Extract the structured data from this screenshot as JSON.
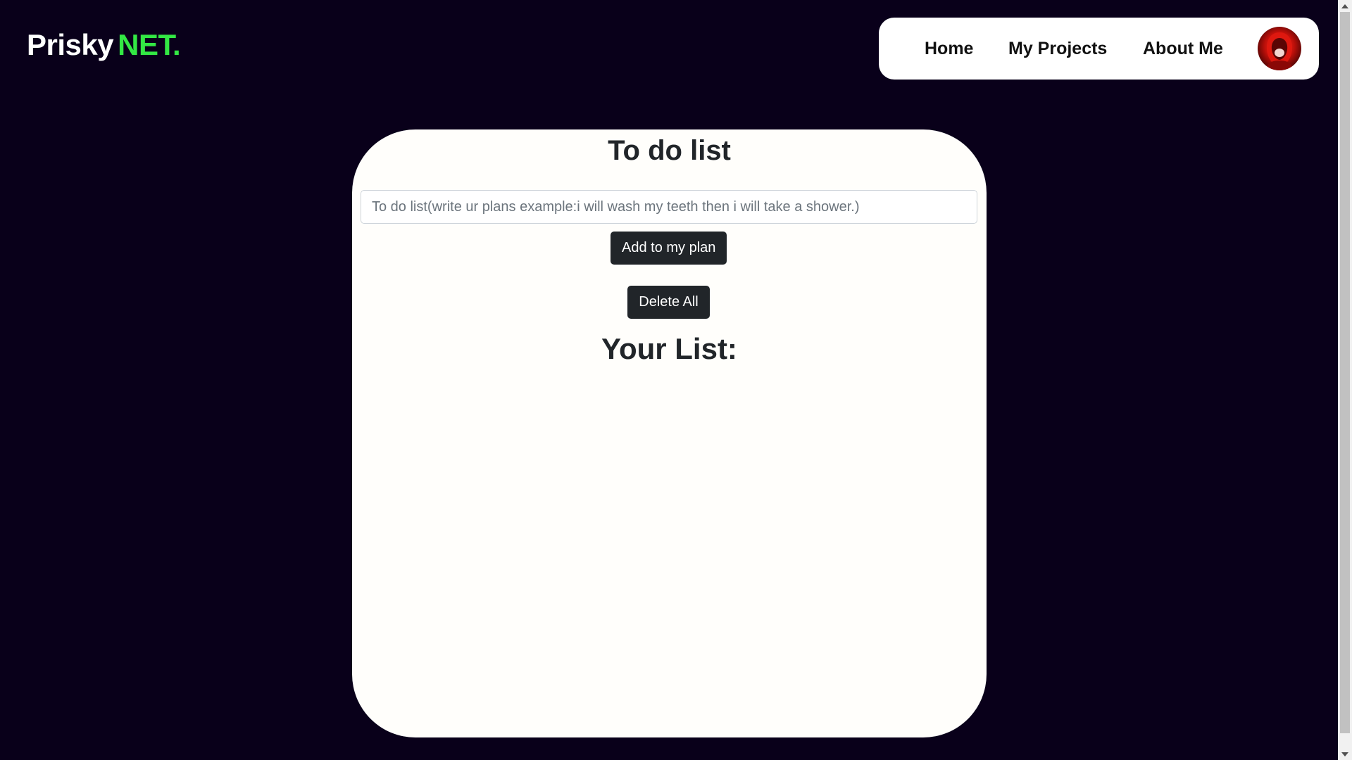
{
  "logo": {
    "text": "Prisky",
    "accent": "NET.",
    "accent_color": "#33e844"
  },
  "nav": {
    "items": [
      {
        "label": "Home"
      },
      {
        "label": "My Projects"
      },
      {
        "label": "About Me"
      }
    ],
    "avatar_icon": "profile-avatar-red-hood"
  },
  "todo": {
    "title": "To do list",
    "input_value": "",
    "input_placeholder": "To do list(write ur plans example:i will wash my teeth then i will take a shower.)",
    "add_button": "Add to my plan",
    "delete_button": "Delete All",
    "list_title": "Your List:",
    "items": []
  },
  "colors": {
    "background": "#09001a",
    "card": "#fffefb",
    "button": "#212529"
  }
}
